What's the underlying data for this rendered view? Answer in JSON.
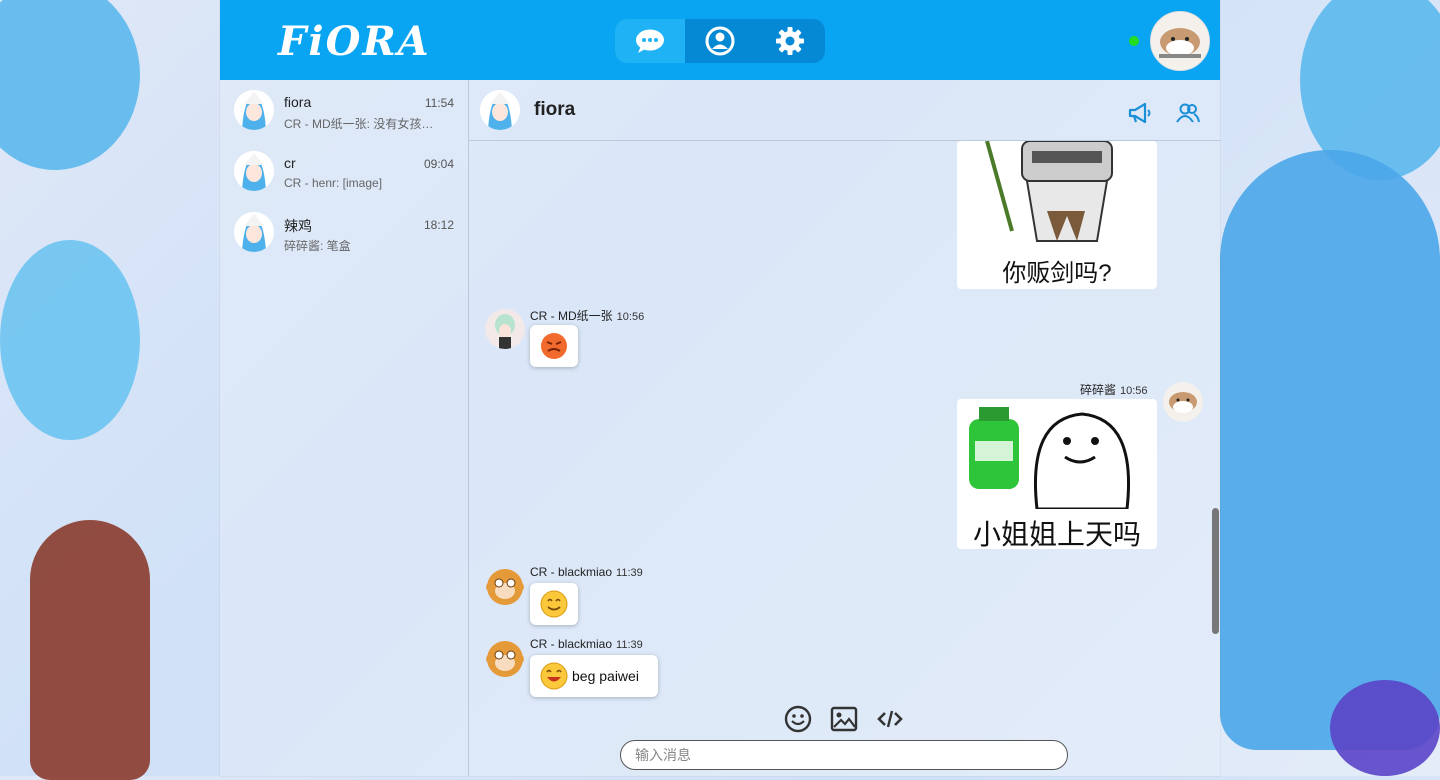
{
  "app": {
    "logo": "FiORA",
    "accent": "#0aa5f2"
  },
  "nav": {
    "tabs": [
      {
        "icon": "chat-bubble-icon",
        "active": true
      },
      {
        "icon": "user-circle-icon",
        "active": false
      },
      {
        "icon": "gear-icon",
        "active": false
      }
    ],
    "online_status_color": "#22dd22"
  },
  "conversations": [
    {
      "name": "fiora",
      "time": "11:54",
      "preview": "CR - MD纸一张: 没有女孩…"
    },
    {
      "name": "cr",
      "time": "09:04",
      "preview": "CR - henr: [image]"
    },
    {
      "name": "辣鸡",
      "time": "18:12",
      "preview": "碎碎酱: 笔盒"
    }
  ],
  "chat": {
    "title": "fiora",
    "header_icons": [
      "megaphone-icon",
      "group-members-icon"
    ]
  },
  "messages": [
    {
      "sender": "",
      "time": "",
      "type": "sticker",
      "caption": "你贩剑吗?",
      "own": true
    },
    {
      "sender": "CR - MD纸一张",
      "time": "10:56",
      "type": "emoji",
      "emoji": "angry-face-icon",
      "own": false
    },
    {
      "sender": "碎碎酱",
      "time": "10:56",
      "type": "sticker",
      "caption": "小姐姐上天吗",
      "own": true
    },
    {
      "sender": "CR - blackmiao",
      "time": "11:39",
      "type": "emoji",
      "emoji": "smile-face-icon",
      "own": false
    },
    {
      "sender": "CR - blackmiao",
      "time": "11:39",
      "type": "emoji-text",
      "emoji": "grin-face-icon",
      "text": "beg paiwei",
      "own": false
    }
  ],
  "composer": {
    "tools": [
      "emoji-icon",
      "image-icon",
      "code-icon"
    ],
    "placeholder": "输入消息"
  }
}
